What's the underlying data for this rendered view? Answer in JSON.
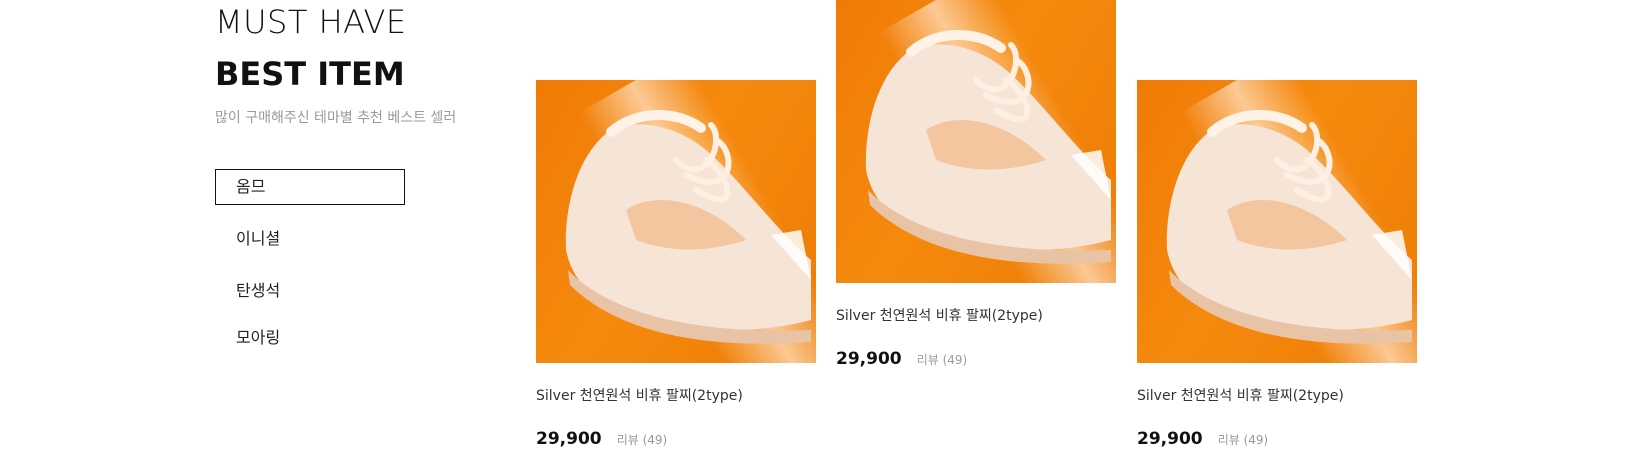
{
  "header": {
    "title_line1": "MUST HAVE",
    "title_line2": "BEST ITEM",
    "subtitle": "많이 구매해주신 테마별 추천 베스트 셀러"
  },
  "tabs": [
    {
      "label": "옴므",
      "active": true
    },
    {
      "label": "이니셜",
      "active": false
    },
    {
      "label": "탄생석",
      "active": false
    },
    {
      "label": "모아링",
      "active": false
    }
  ],
  "products": [
    {
      "name": "Silver 천연원석 비휴 팔찌(2type)",
      "price": "29,900",
      "review": "리뷰 (49)",
      "image": "white-sneaker-orange-background"
    },
    {
      "name": "Silver 천연원석 비휴 팔찌(2type)",
      "price": "29,900",
      "review": "리뷰 (49)",
      "image": "white-sneaker-orange-background"
    },
    {
      "name": "Silver 천연원석 비휴 팔찌(2type)",
      "price": "29,900",
      "review": "리뷰 (49)",
      "image": "white-sneaker-orange-background"
    }
  ],
  "colors": {
    "accent_orange": "#f07a06",
    "text_muted": "#9a9a9a",
    "text_dark": "#111111"
  }
}
